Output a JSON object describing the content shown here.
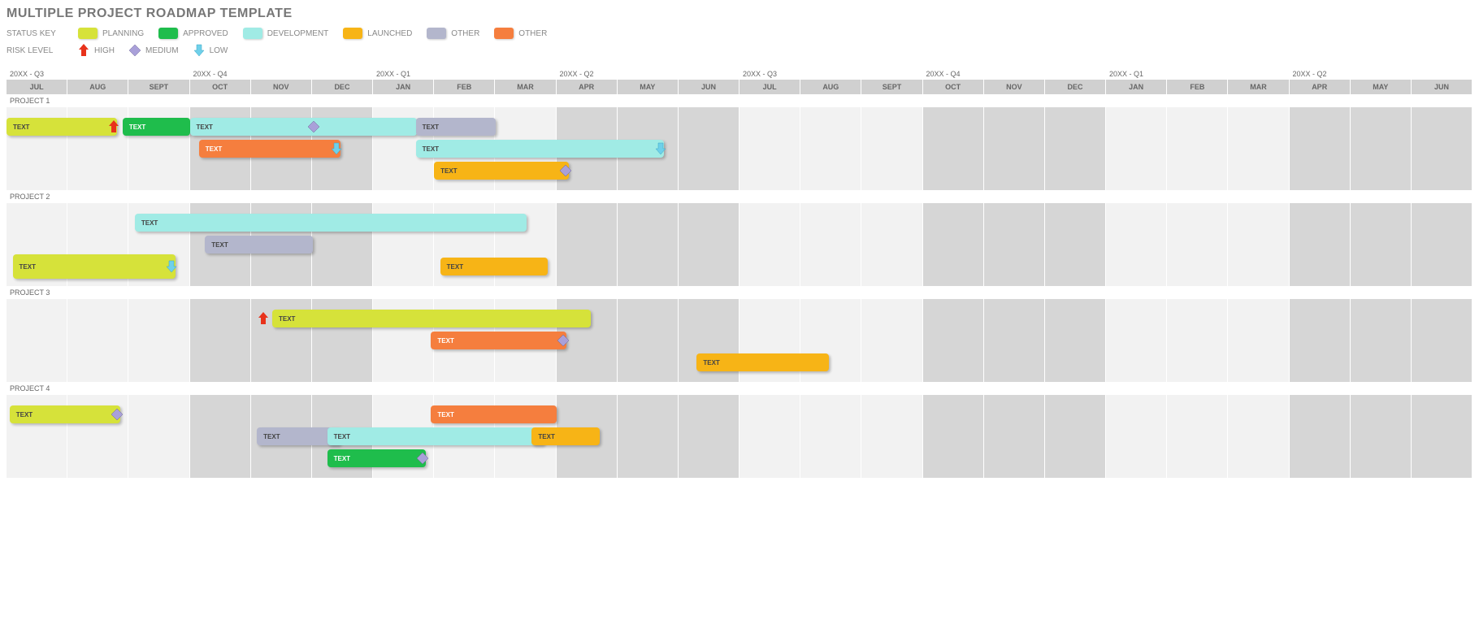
{
  "title": "MULTIPLE PROJECT ROADMAP TEMPLATE",
  "legend": {
    "status_key_label": "STATUS KEY",
    "risk_level_label": "RISK LEVEL",
    "statuses": {
      "planning": {
        "label": "PLANNING",
        "color": "#d6e23a"
      },
      "approved": {
        "label": "APPROVED",
        "color": "#1fbd4c"
      },
      "development": {
        "label": "DEVELOPMENT",
        "color": "#a0ebe5"
      },
      "launched": {
        "label": "LAUNCHED",
        "color": "#f7b416"
      },
      "other1": {
        "label": "OTHER",
        "color": "#b3b6cc"
      },
      "other2": {
        "label": "OTHER",
        "color": "#f57e3e"
      }
    },
    "risks": {
      "high": {
        "label": "HIGH",
        "color": "#e8321b"
      },
      "medium": {
        "label": "MEDIUM",
        "color": "#a9a0d9"
      },
      "low": {
        "label": "LOW",
        "color": "#6fd0ea"
      }
    }
  },
  "chart_data": {
    "type": "gantt",
    "quarters": [
      "20XX - Q3",
      "20XX - Q4",
      "20XX - Q1",
      "20XX - Q2",
      "20XX - Q3",
      "20XX - Q4",
      "20XX - Q1",
      "20XX - Q2"
    ],
    "months": [
      "JUL",
      "AUG",
      "SEPT",
      "OCT",
      "NOV",
      "DEC",
      "JAN",
      "FEB",
      "MAR",
      "APR",
      "MAY",
      "JUN",
      "JUL",
      "AUG",
      "SEPT",
      "OCT",
      "NOV",
      "DEC",
      "JAN",
      "FEB",
      "MAR",
      "APR",
      "MAY",
      "JUN"
    ],
    "month_count": 24,
    "projects": [
      {
        "name": "PROJECT 1",
        "rows": [
          [
            {
              "label": "TEXT",
              "status": "planning",
              "start": 0.0,
              "span": 1.6,
              "risk": "high",
              "risk_at": "end"
            },
            {
              "label": "TEXT",
              "status": "approved",
              "start": 1.9,
              "span": 0.9
            },
            {
              "label": "TEXT",
              "status": "development",
              "start": 3.0,
              "span": 3.5,
              "risk": "medium",
              "risk_at": "mid"
            },
            {
              "label": "TEXT",
              "status": "other1",
              "start": 6.7,
              "span": 1.1
            }
          ],
          [
            {
              "label": "TEXT",
              "status": "other2",
              "start": 3.15,
              "span": 2.1,
              "risk": "low",
              "risk_at": "end"
            },
            {
              "label": "TEXT",
              "status": "development",
              "start": 6.7,
              "span": 3.85,
              "risk": "low",
              "risk_at": "end"
            }
          ],
          [
            {
              "label": "TEXT",
              "status": "launched",
              "start": 7.0,
              "span": 2.0,
              "risk": "medium",
              "risk_at": "end"
            }
          ]
        ]
      },
      {
        "name": "PROJECT 2",
        "rows": [
          [
            {
              "label": "TEXT",
              "status": "development",
              "start": 2.1,
              "span": 6.2
            }
          ],
          [
            {
              "label": "TEXT",
              "status": "other1",
              "start": 3.25,
              "span": 1.55
            }
          ],
          [
            {
              "label": "TEXT",
              "status": "planning",
              "start": 0.1,
              "span": 2.45,
              "risk": "low",
              "risk_at": "end",
              "tall": true
            },
            {
              "label": "TEXT",
              "status": "launched",
              "start": 7.1,
              "span": 1.55
            }
          ]
        ]
      },
      {
        "name": "PROJECT 3",
        "rows": [
          [
            {
              "label": "TEXT",
              "status": "planning",
              "start": 4.35,
              "span": 5.0,
              "risk": "high",
              "risk_at": "start"
            }
          ],
          [
            {
              "label": "TEXT",
              "status": "other2",
              "start": 6.95,
              "span": 2.0,
              "risk": "medium",
              "risk_at": "end"
            }
          ],
          [
            {
              "label": "TEXT",
              "status": "launched",
              "start": 11.3,
              "span": 1.95
            }
          ]
        ]
      },
      {
        "name": "PROJECT 4",
        "rows": [
          [
            {
              "label": "TEXT",
              "status": "planning",
              "start": 0.05,
              "span": 1.6,
              "risk": "medium",
              "risk_at": "end"
            },
            {
              "label": "TEXT",
              "status": "other2",
              "start": 6.95,
              "span": 1.85
            }
          ],
          [
            {
              "label": "TEXT",
              "status": "other1",
              "start": 4.1,
              "span": 1.15
            },
            {
              "label": "TEXT",
              "status": "development",
              "start": 5.25,
              "span": 3.35
            },
            {
              "label": "TEXT",
              "status": "launched",
              "start": 8.6,
              "span": 0.9
            }
          ],
          [
            {
              "label": "TEXT",
              "status": "approved",
              "start": 5.25,
              "span": 1.4,
              "risk": "medium",
              "risk_at": "end"
            }
          ]
        ]
      }
    ]
  }
}
